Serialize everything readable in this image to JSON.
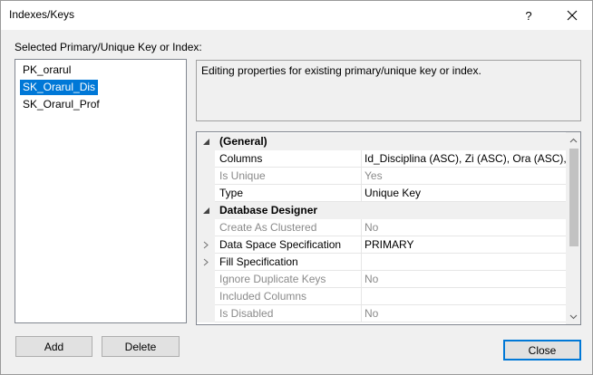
{
  "window": {
    "title": "Indexes/Keys",
    "help_label": "?"
  },
  "keys": {
    "section_label": "Selected Primary/Unique Key or Index:",
    "items": [
      {
        "label": "PK_orarul",
        "selected": false
      },
      {
        "label": "SK_Orarul_Dis",
        "selected": true
      },
      {
        "label": "SK_Orarul_Prof",
        "selected": false
      }
    ]
  },
  "description": "Editing properties for existing primary/unique key or index.",
  "properties": {
    "categories": [
      {
        "name": "(General)",
        "rows": [
          {
            "name": "Columns",
            "value": "Id_Disciplina (ASC), Zi (ASC), Ora (ASC), Id",
            "disabled": false,
            "expandable": false
          },
          {
            "name": "Is Unique",
            "value": "Yes",
            "disabled": true,
            "expandable": false
          },
          {
            "name": "Type",
            "value": "Unique Key",
            "disabled": false,
            "expandable": false
          }
        ]
      },
      {
        "name": "Database Designer",
        "rows": [
          {
            "name": "Create As Clustered",
            "value": "No",
            "disabled": true,
            "expandable": false
          },
          {
            "name": "Data Space Specification",
            "value": "PRIMARY",
            "disabled": false,
            "expandable": true
          },
          {
            "name": "Fill Specification",
            "value": "",
            "disabled": false,
            "expandable": true
          },
          {
            "name": "Ignore Duplicate Keys",
            "value": "No",
            "disabled": true,
            "expandable": false
          },
          {
            "name": "Included Columns",
            "value": "",
            "disabled": true,
            "expandable": false
          },
          {
            "name": "Is Disabled",
            "value": "No",
            "disabled": true,
            "expandable": false
          }
        ]
      }
    ]
  },
  "buttons": {
    "add": "Add",
    "delete": "Delete",
    "close": "Close"
  },
  "colors": {
    "selection": "#0078d7",
    "disabled_text": "#8a8a8a"
  }
}
